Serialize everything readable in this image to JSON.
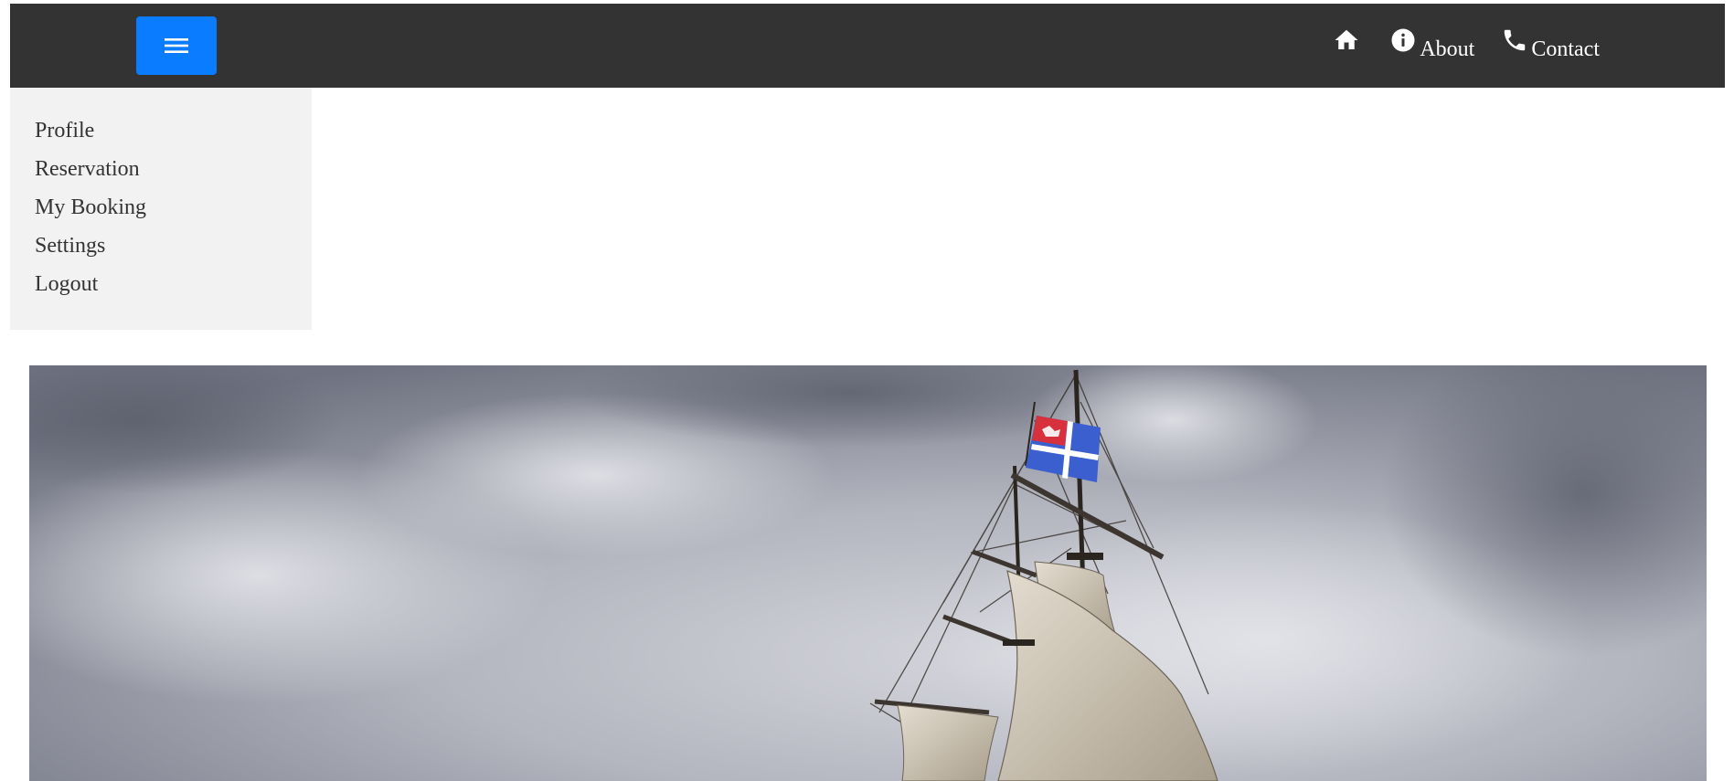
{
  "header": {
    "menu_button_icon": "hamburger-menu-icon",
    "accent_color": "#0a7cff",
    "background_color": "#333333",
    "nav": [
      {
        "icon": "home-icon",
        "label": ""
      },
      {
        "icon": "info-icon",
        "label": "About"
      },
      {
        "icon": "phone-icon",
        "label": "Contact"
      }
    ]
  },
  "sidebar": {
    "background_color": "#f2f2f2",
    "items": [
      {
        "label": "Profile"
      },
      {
        "label": "Reservation"
      },
      {
        "label": "My Booking"
      },
      {
        "label": "Settings"
      },
      {
        "label": "Logout"
      }
    ]
  },
  "hero": {
    "image_subject": "tall ship with sails and flag against cloudy sky"
  }
}
